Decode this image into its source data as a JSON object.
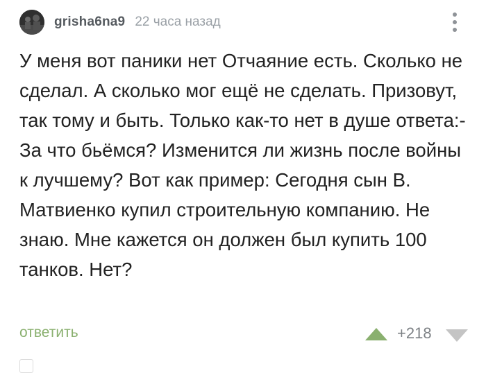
{
  "comment": {
    "author": "grisha6na9",
    "timestamp": "22 часа назад",
    "text": "У меня вот паники нет Отчаяние есть. Сколько не сделал. А сколько мог ещё не сделать. Призовут, так тому и быть. Только как-то нет в душе ответа:-За что бьёмся? Изменится ли жизнь после войны к лучшему? Вот как пример: Сегодня сын В. Матвиенко купил строительную компанию. Не знаю. Мне кажется он должен был купить 100 танков. Нет?",
    "reply_label": "ответить",
    "rating": "+218"
  },
  "icons": {
    "menu": "more-vertical-icon",
    "upvote": "upvote-triangle-icon",
    "downvote": "downvote-triangle-icon"
  },
  "colors": {
    "author": "#555a5f",
    "timestamp": "#9aa0a6",
    "text": "#222222",
    "reply": "#8ab06f",
    "upvote": "#8ab06f",
    "downvote": "#c4c4c4",
    "rating": "#7d8185"
  }
}
